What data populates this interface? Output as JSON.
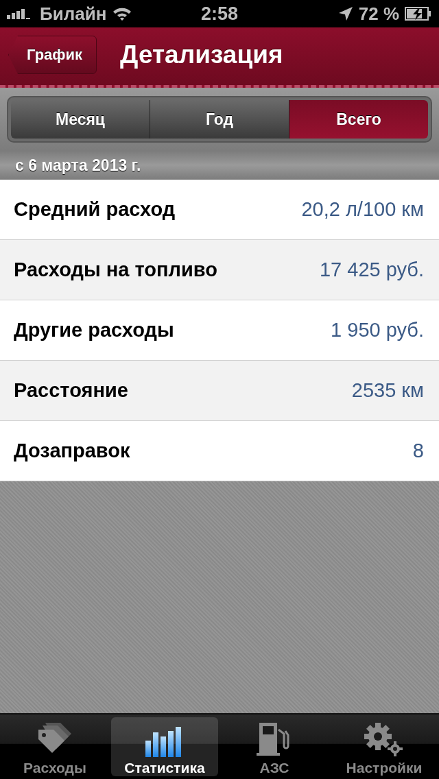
{
  "status_bar": {
    "carrier": "Билайн",
    "time": "2:58",
    "battery": "72 %"
  },
  "nav_bar": {
    "back_button": "График",
    "title": "Детализация"
  },
  "segments": [
    {
      "label": "Месяц",
      "selected": false
    },
    {
      "label": "Год",
      "selected": false
    },
    {
      "label": "Всего",
      "selected": true
    }
  ],
  "section_header": "с 6 марта 2013 г.",
  "rows": [
    {
      "label": "Средний расход",
      "value": "20,2 л/100 км"
    },
    {
      "label": "Расходы на топливо",
      "value": "17 425 руб."
    },
    {
      "label": "Другие расходы",
      "value": "1 950 руб."
    },
    {
      "label": "Расстояние",
      "value": "2535 км"
    },
    {
      "label": "Дозаправок",
      "value": "8"
    }
  ],
  "tab_bar": [
    {
      "kind": "tags",
      "label": "Расходы",
      "selected": false
    },
    {
      "kind": "chart",
      "label": "Статистика",
      "selected": true
    },
    {
      "kind": "fuel",
      "label": "АЗС",
      "selected": false
    },
    {
      "kind": "gears",
      "label": "Настройки",
      "selected": false
    }
  ]
}
